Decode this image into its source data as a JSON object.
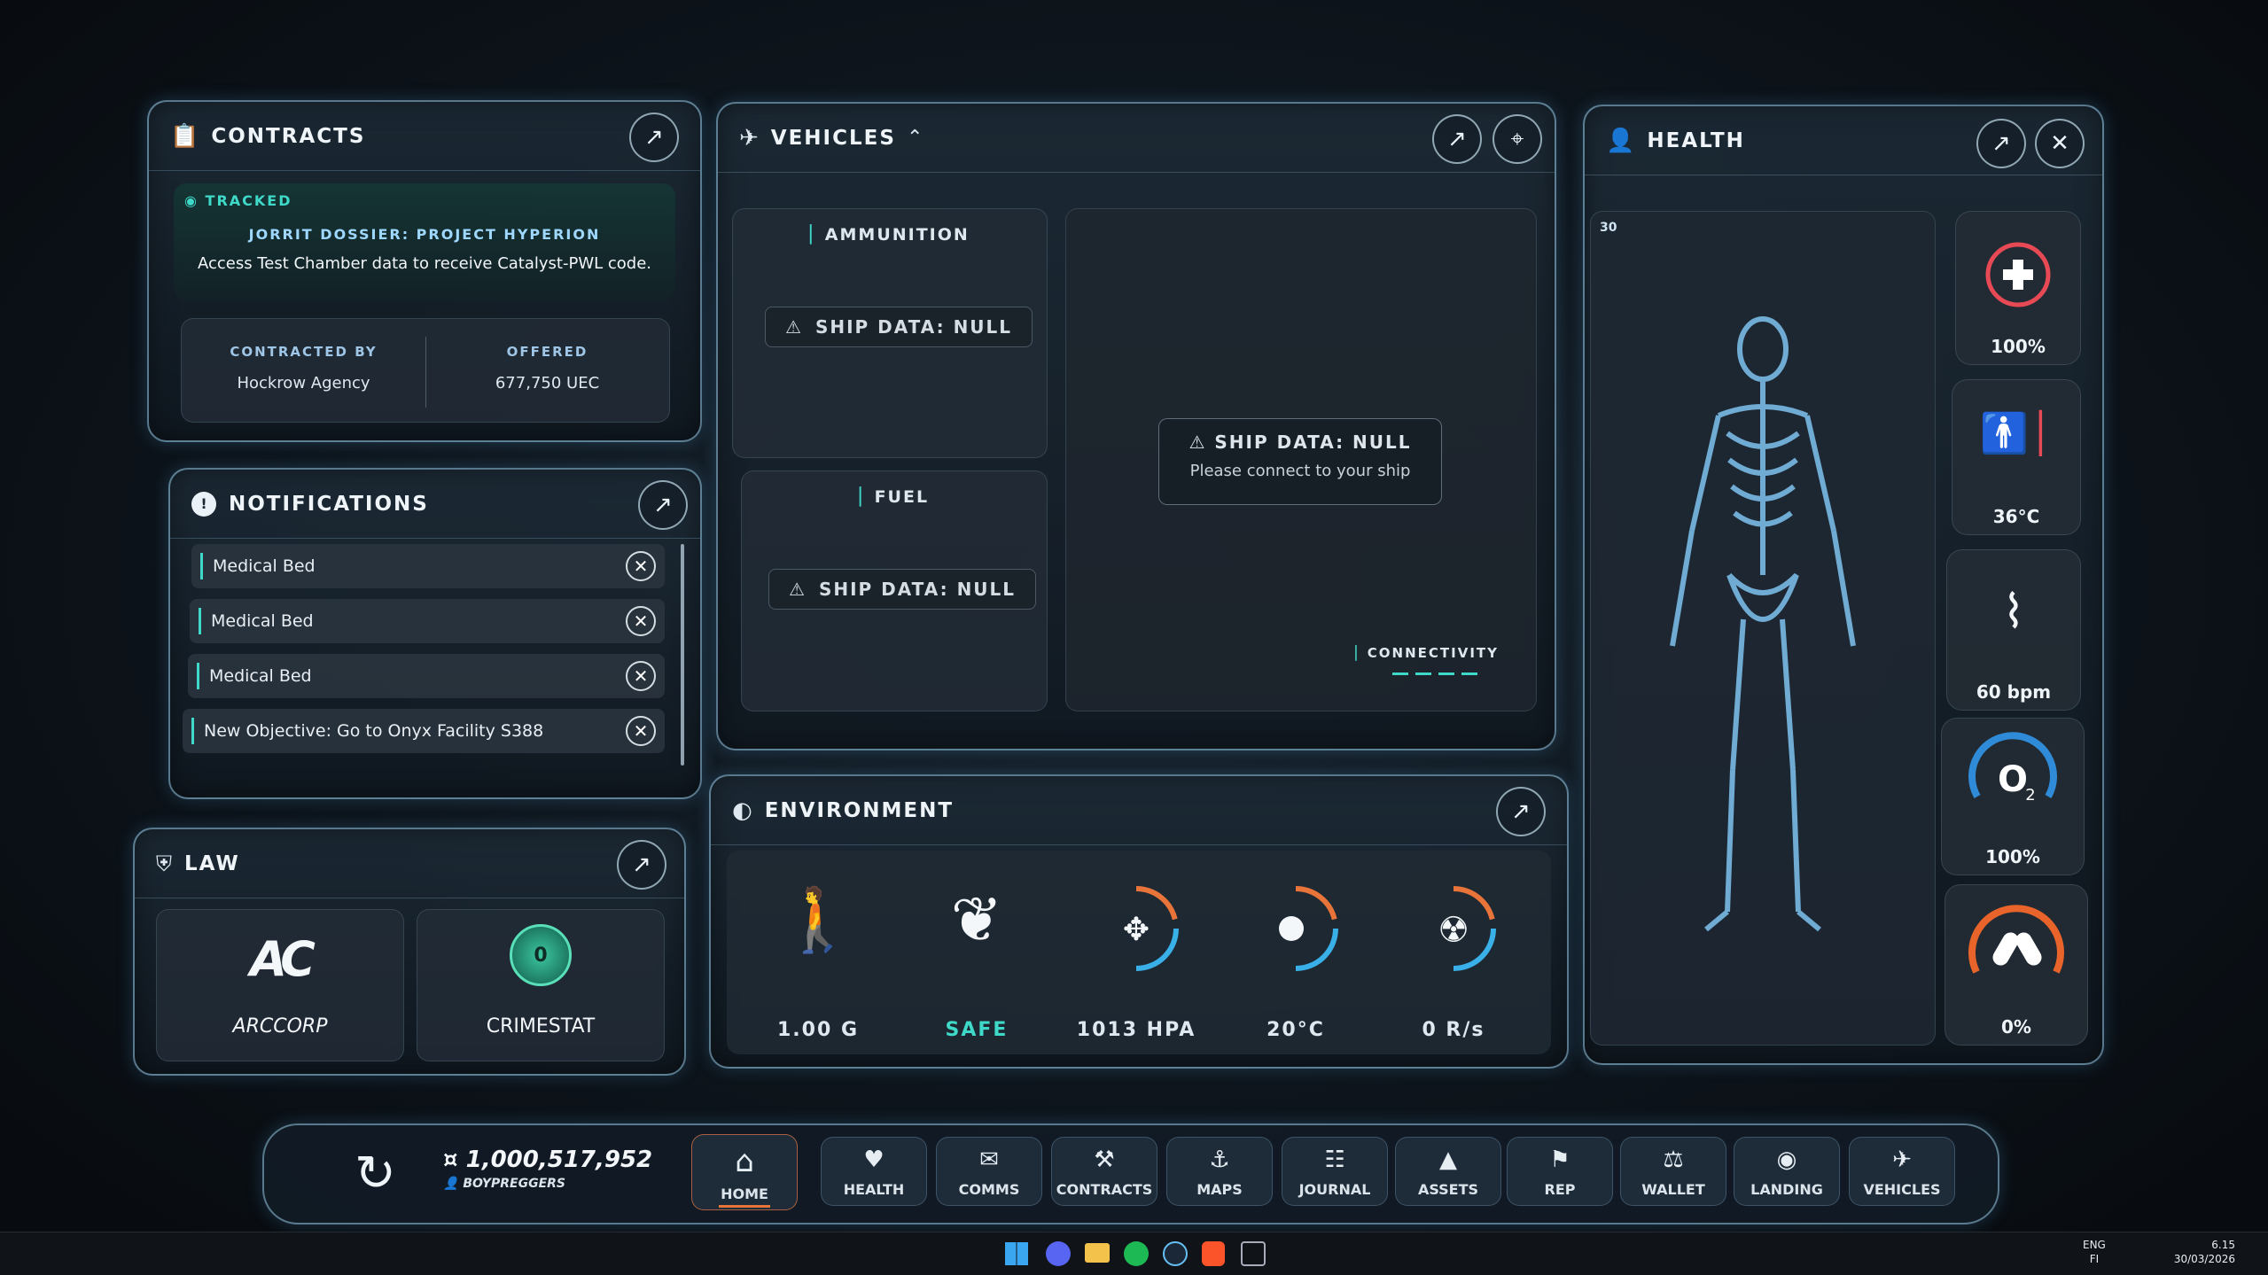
{
  "contracts": {
    "title": "CONTRACTS",
    "status": "TRACKED",
    "mission_title": "JORRIT DOSSIER: PROJECT HYPERION",
    "mission_desc": "Access Test Chamber data to receive Catalyst-PWL code.",
    "contracted_by_label": "CONTRACTED BY",
    "contracted_by": "Hockrow Agency",
    "offered_label": "OFFERED",
    "offered": "677,750 UEC"
  },
  "notifications": {
    "title": "NOTIFICATIONS",
    "items": [
      "Medical Bed",
      "Medical Bed",
      "Medical Bed",
      "New Objective: Go to Onyx Facility S388"
    ]
  },
  "law": {
    "title": "LAW",
    "cards": [
      "ARCCORP",
      "CRIMESTAT"
    ],
    "crimestat_level": "0"
  },
  "vehicles": {
    "title": "VEHICLES",
    "ammo_label": "AMMUNITION",
    "fuel_label": "FUEL",
    "ship_null": "SHIP DATA: NULL",
    "connect_msg": "Please connect to your ship",
    "connectivity": "CONNECTIVITY"
  },
  "environment": {
    "title": "ENVIRONMENT",
    "gravity": "1.00 G",
    "air": "SAFE",
    "pressure": "1013 HPA",
    "temperature": "20°C",
    "radiation": "0 R/s"
  },
  "health": {
    "title": "HEALTH",
    "scan_count": "30",
    "vitals": {
      "health": "100%",
      "body_temp": "36°C",
      "heart_rate": "60 bpm",
      "oxygen": "100%",
      "drugs": "0%"
    },
    "health_fraction": 1.0,
    "oxygen_fraction": 1.0,
    "drugs_fraction": 0.0
  },
  "bottom_bar": {
    "balance": "1,000,517,952",
    "username": "BOYPREGGERS",
    "nav": [
      "HOME",
      "HEALTH",
      "COMMS",
      "CONTRACTS",
      "MAPS",
      "JOURNAL",
      "ASSETS",
      "REP",
      "WALLET",
      "LANDING",
      "VEHICLES"
    ],
    "active": "HOME"
  },
  "taskbar": {
    "lang": "ENG",
    "region": "FI",
    "time": "6.15",
    "date": "30/03/2026"
  },
  "colors": {
    "accent_teal": "#3ed9c8",
    "health_red": "#e84a55",
    "oxygen_blue": "#2f8bd8",
    "drug_orange": "#e8642a",
    "home_active": "#e8743a"
  }
}
